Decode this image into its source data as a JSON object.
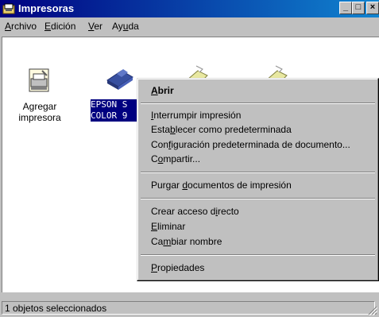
{
  "window": {
    "title": "Impresoras",
    "controls": [
      "_",
      "□",
      "×"
    ]
  },
  "menubar": {
    "items": [
      {
        "label": "Archivo",
        "accel": "A",
        "rest": "rchivo"
      },
      {
        "label": "Edición",
        "accel": "E",
        "rest": "dición"
      },
      {
        "label": "Ver",
        "accel": "V",
        "rest": "er"
      },
      {
        "label": "Ayuda",
        "pre": "Ay",
        "accel": "u",
        "rest": "da"
      }
    ]
  },
  "icons": [
    {
      "name": "add-printer",
      "label_line1": "Agregar",
      "label_line2": "impresora"
    },
    {
      "name": "epson-printer",
      "label_line1": "EPSON S",
      "label_line2": "COLOR 9"
    }
  ],
  "context_menu": {
    "items": [
      {
        "pre": "",
        "accel": "A",
        "rest": "brir",
        "default": true
      },
      {
        "pre": "",
        "accel": "I",
        "rest": "nterrumpir impresión"
      },
      {
        "pre": "Esta",
        "accel": "b",
        "rest": "lecer como predeterminada"
      },
      {
        "pre": "Con",
        "accel": "f",
        "rest": "iguración predeterminada de documento..."
      },
      {
        "pre": "C",
        "accel": "o",
        "rest": "mpartir..."
      },
      {
        "pre": "Purgar ",
        "accel": "d",
        "rest": "ocumentos de impresión"
      },
      {
        "pre": "Crear acceso d",
        "accel": "i",
        "rest": "recto"
      },
      {
        "pre": "",
        "accel": "E",
        "rest": "liminar"
      },
      {
        "pre": "Ca",
        "accel": "m",
        "rest": "biar nombre"
      },
      {
        "pre": "",
        "accel": "P",
        "rest": "ropiedades"
      }
    ]
  },
  "status": {
    "text": "1 objetos seleccionados"
  }
}
